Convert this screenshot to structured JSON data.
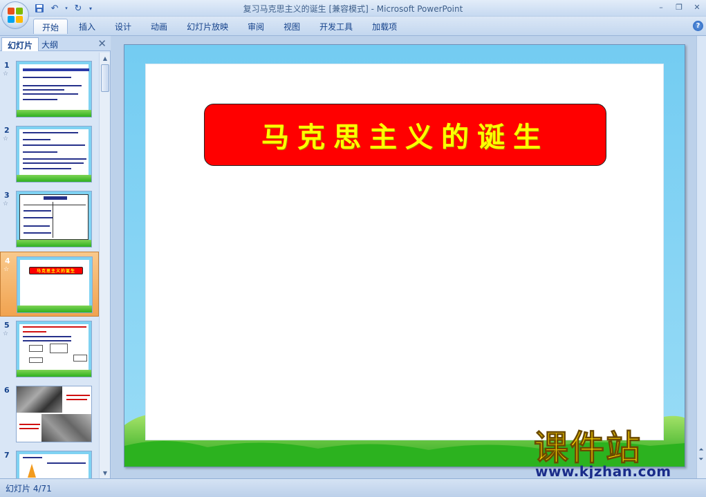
{
  "window": {
    "title": "复习马克思主义的诞生 [兼容模式] - Microsoft PowerPoint",
    "controls": [
      "–",
      "❐",
      "✕"
    ]
  },
  "quick_access": {
    "save_icon": "save-icon",
    "undo_icon": "undo-icon",
    "redo_icon": "redo-icon",
    "customize_icon": "dropdown-icon"
  },
  "ribbon": {
    "tabs": [
      {
        "label": "开始",
        "active": true
      },
      {
        "label": "插入"
      },
      {
        "label": "设计"
      },
      {
        "label": "动画"
      },
      {
        "label": "幻灯片放映"
      },
      {
        "label": "审阅"
      },
      {
        "label": "视图"
      },
      {
        "label": "开发工具"
      },
      {
        "label": "加载项"
      }
    ],
    "help": "?"
  },
  "left_pane": {
    "tab_slides": "幻灯片",
    "tab_outline": "大纲",
    "close": "✕",
    "thumbnails": [
      {
        "num": "1"
      },
      {
        "num": "2"
      },
      {
        "num": "3"
      },
      {
        "num": "4",
        "selected": true
      },
      {
        "num": "5"
      },
      {
        "num": "6"
      },
      {
        "num": "7"
      }
    ]
  },
  "slide": {
    "title": "马克思主义的诞生",
    "title_bg": "#ff0000",
    "title_color": "#ffff00"
  },
  "watermark": {
    "big": "课件站",
    "small": "www.kjzhan.com"
  },
  "status": {
    "slide_position": "幻灯片 4/71"
  }
}
